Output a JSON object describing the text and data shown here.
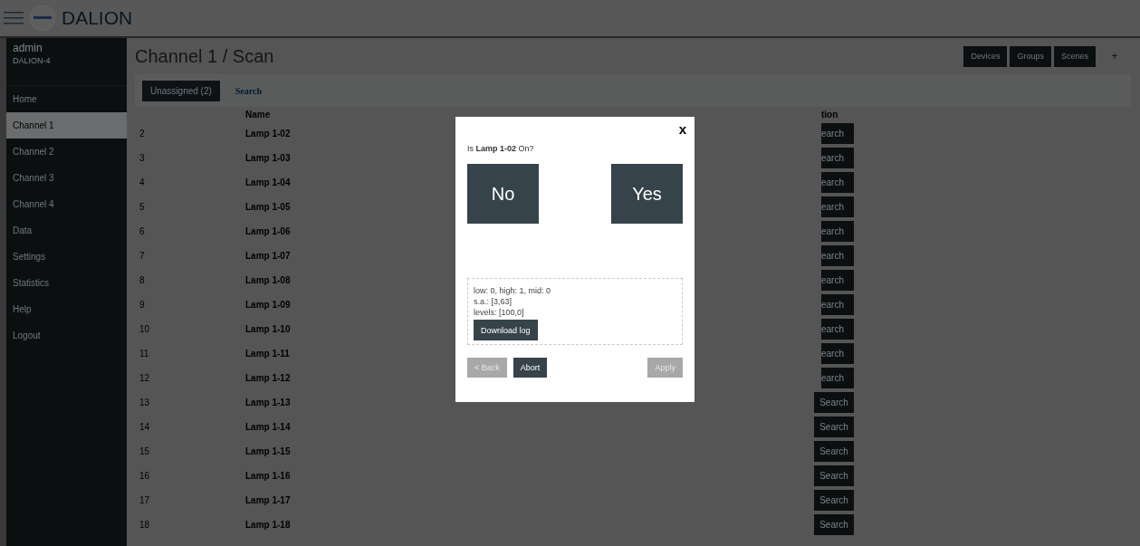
{
  "top_bar": {
    "brand": "DALION"
  },
  "sidebar": {
    "user": "admin",
    "device": "DALION-4",
    "items": [
      {
        "label": "Home",
        "selected": false
      },
      {
        "label": "Channel 1",
        "selected": true
      },
      {
        "label": "Channel 2",
        "selected": false
      },
      {
        "label": "Channel 3",
        "selected": false
      },
      {
        "label": "Channel 4",
        "selected": false
      },
      {
        "label": "Data",
        "selected": false
      },
      {
        "label": "Settings",
        "selected": false
      },
      {
        "label": "Statistics",
        "selected": false
      },
      {
        "label": "Help",
        "selected": false
      },
      {
        "label": "Logout",
        "selected": false
      }
    ]
  },
  "page": {
    "title": "Channel 1 / Scan",
    "view_buttons": [
      "Devices",
      "Groups",
      "Scenes"
    ],
    "add_button": "+"
  },
  "tabs": [
    {
      "label": "Unassigned (2)",
      "selected": true
    },
    {
      "label": "Search",
      "selected": false
    }
  ],
  "table": {
    "columns": [
      "Name",
      "tion"
    ],
    "rows": [
      {
        "number": "2",
        "name": "Lamp 1-02",
        "action": "earch"
      },
      {
        "number": "3",
        "name": "Lamp 1-03",
        "action": "earch"
      },
      {
        "number": "4",
        "name": "Lamp 1-04",
        "action": "earch"
      },
      {
        "number": "5",
        "name": "Lamp 1-05",
        "action": "earch"
      },
      {
        "number": "6",
        "name": "Lamp 1-06",
        "action": "earch"
      },
      {
        "number": "7",
        "name": "Lamp 1-07",
        "action": "earch"
      },
      {
        "number": "8",
        "name": "Lamp 1-08",
        "action": "earch"
      },
      {
        "number": "9",
        "name": "Lamp 1-09",
        "action": "earch"
      },
      {
        "number": "10",
        "name": "Lamp 1-10",
        "action": "earch"
      },
      {
        "number": "11",
        "name": "Lamp 1-11",
        "action": "earch"
      },
      {
        "number": "12",
        "name": "Lamp 1-12",
        "action": "earch"
      },
      {
        "number": "13",
        "name": "Lamp 1-13",
        "action": "Search"
      },
      {
        "number": "14",
        "name": "Lamp 1-14",
        "action": "Search"
      },
      {
        "number": "15",
        "name": "Lamp 1-15",
        "action": "Search"
      },
      {
        "number": "16",
        "name": "Lamp 1-16",
        "action": "Search"
      },
      {
        "number": "17",
        "name": "Lamp 1-17",
        "action": "Search"
      },
      {
        "number": "18",
        "name": "Lamp 1-18",
        "action": "Search"
      }
    ]
  },
  "dialog": {
    "close": "x",
    "question": "Is **Lamp 1-02** On?",
    "answers": [
      "No",
      "Yes"
    ],
    "log_lines": [
      "low: 0,  high: 1,  mid: 0",
      "s.a.: [3,63]",
      "levels: [100,0]"
    ],
    "download_button": "Download log",
    "footer_buttons": [
      {
        "label": "< Back",
        "disabled": true
      },
      {
        "label": "Abort",
        "disabled": false
      },
      {
        "label": "Apply",
        "disabled": true
      }
    ]
  }
}
